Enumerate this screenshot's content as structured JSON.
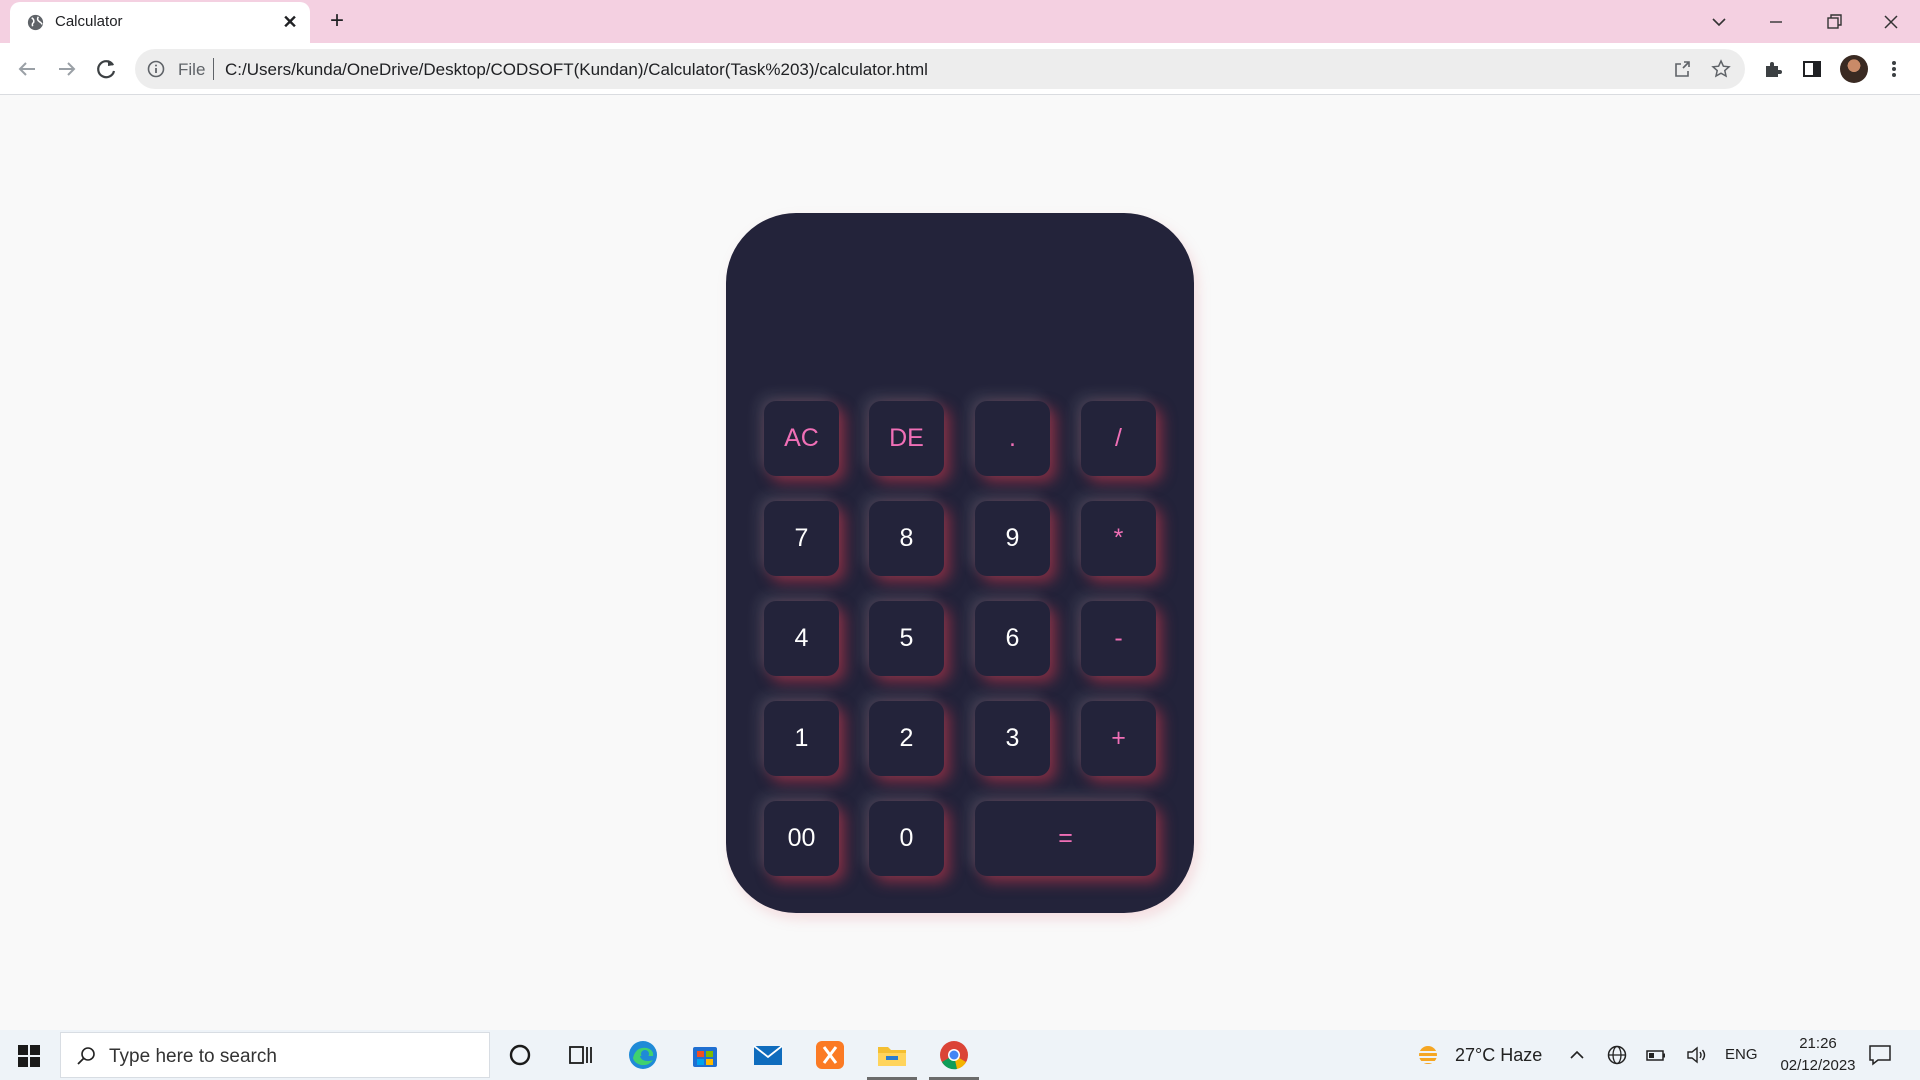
{
  "browser": {
    "tab_title": "Calculator",
    "close_glyph": "✕",
    "new_tab_glyph": "+",
    "address_scheme_label": "File",
    "address_url": "C:/Users/kunda/OneDrive/Desktop/CODSOFT(Kundan)/Calculator(Task%203)/calculator.html"
  },
  "calculator": {
    "display_value": "",
    "keys": {
      "ac": "AC",
      "de": "DE",
      "dot": ".",
      "divide": "/",
      "seven": "7",
      "eight": "8",
      "nine": "9",
      "multiply": "*",
      "four": "4",
      "five": "5",
      "six": "6",
      "minus": "-",
      "one": "1",
      "two": "2",
      "three": "3",
      "plus": "+",
      "double_zero": "00",
      "zero": "0",
      "equals": "="
    },
    "colors": {
      "body": "#23233a",
      "digit_text": "#ffffff",
      "operator_text": "#f06fb6",
      "glow": "#d2374b"
    }
  },
  "taskbar": {
    "search_placeholder": "Type here to search",
    "weather": "27°C  Haze",
    "language": "ENG",
    "time": "21:26",
    "date": "02/12/2023"
  }
}
